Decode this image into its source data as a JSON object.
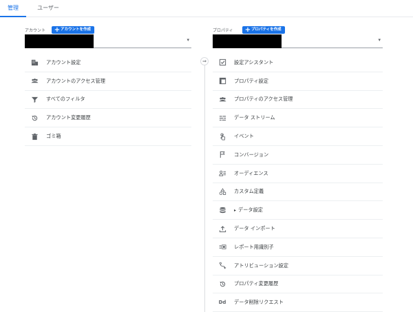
{
  "tabs": [
    {
      "label": "管理",
      "active": true
    },
    {
      "label": "ユーザー",
      "active": false
    }
  ],
  "account": {
    "label": "アカウント",
    "create_button": "アカウントを作成",
    "items": [
      {
        "label": "アカウント設定",
        "icon": "building-icon"
      },
      {
        "label": "アカウントのアクセス管理",
        "icon": "people-icon"
      },
      {
        "label": "すべてのフィルタ",
        "icon": "filter-icon"
      },
      {
        "label": "アカウント変更履歴",
        "icon": "history-icon"
      },
      {
        "label": "ゴミ箱",
        "icon": "trash-icon"
      }
    ]
  },
  "property": {
    "label": "プロパティ",
    "create_button": "プロパティを作成",
    "items": [
      {
        "label": "設定アシスタント",
        "icon": "checkbox-icon"
      },
      {
        "label": "プロパティ設定",
        "icon": "window-icon"
      },
      {
        "label": "プロパティのアクセス管理",
        "icon": "people-icon"
      },
      {
        "label": "データ ストリーム",
        "icon": "streams-icon"
      },
      {
        "label": "イベント",
        "icon": "touch-icon"
      },
      {
        "label": "コンバージョン",
        "icon": "flag-icon"
      },
      {
        "label": "オーディエンス",
        "icon": "audience-icon"
      },
      {
        "label": "カスタム定義",
        "icon": "shapes-icon"
      },
      {
        "label": "データ設定",
        "icon": "database-icon"
      },
      {
        "label": "データ インポート",
        "icon": "upload-icon"
      },
      {
        "label": "レポート用識別子",
        "icon": "identifier-icon"
      },
      {
        "label": "アトリビューション設定",
        "icon": "attribution-icon"
      },
      {
        "label": "プロパティ変更履歴",
        "icon": "history-icon"
      },
      {
        "label": "データ削除リクエスト",
        "icon": "dd-icon"
      }
    ]
  },
  "icons": {
    "plus": "+",
    "dropdown": "▾",
    "caret": "▸",
    "collapse": "⇒",
    "dd": "Dd"
  },
  "colors": {
    "accent": "#1a73e8",
    "icon": "#5f6368"
  }
}
